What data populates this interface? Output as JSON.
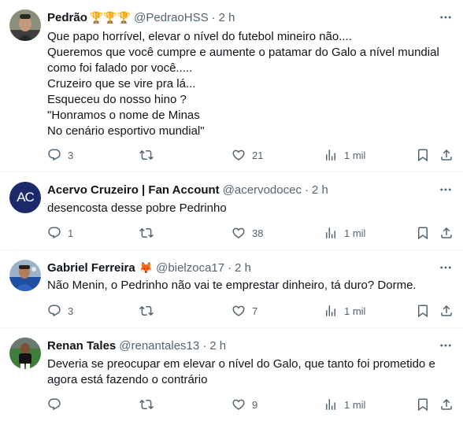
{
  "tweets": [
    {
      "name": "Pedrão",
      "badges": "🏆🏆🏆",
      "handle": "@PedraoHSS",
      "time": "2 h",
      "lines": [
        "Que papo horrível, elevar o nível do futebol mineiro não....",
        "Queremos que você cumpre e aumente o patamar do Galo a nível mundial",
        "como foi falado por você.....",
        "Cruzeiro que se vire pra lá...",
        "Esqueceu do nosso hino ?",
        "\"Honramos o nome de Minas",
        "No cenário esportivo mundial\""
      ],
      "replies": "3",
      "reposts": "",
      "likes": "21",
      "views": "1 mil"
    },
    {
      "name": "Acervo Cruzeiro | Fan Account",
      "badges": "",
      "handle": "@acervodocec",
      "time": "2 h",
      "lines": [
        "desencosta desse pobre Pedrinho"
      ],
      "replies": "1",
      "reposts": "",
      "likes": "38",
      "views": "1 mil"
    },
    {
      "name": "Gabriel Ferreira",
      "badges": "🦊",
      "handle": "@bielzoca17",
      "time": "2 h",
      "lines": [
        "Não Menin, o Pedrinho não vai te emprestar dinheiro, tá duro? Dorme."
      ],
      "replies": "3",
      "reposts": "",
      "likes": "7",
      "views": "1 mil"
    },
    {
      "name": "Renan Tales",
      "badges": "",
      "handle": "@renantales13",
      "time": "2 h",
      "lines": [
        "Deveria se preocupar em elevar o nível do Galo, que tanto foi prometido e",
        "agora está fazendo o contrário"
      ],
      "replies": "",
      "reposts": "",
      "likes": "9",
      "views": "1 mil"
    }
  ],
  "separator": "·",
  "avatar_text": {
    "acervo": "AC"
  },
  "icons": [
    "reply-icon",
    "repost-icon",
    "like-icon",
    "views-icon",
    "bookmark-icon",
    "share-icon",
    "more-icon"
  ],
  "colors": {
    "text": "#0f1419",
    "muted": "#536471",
    "divider": "#eff3f4",
    "acervo_avatar": "#1c2a6b"
  }
}
